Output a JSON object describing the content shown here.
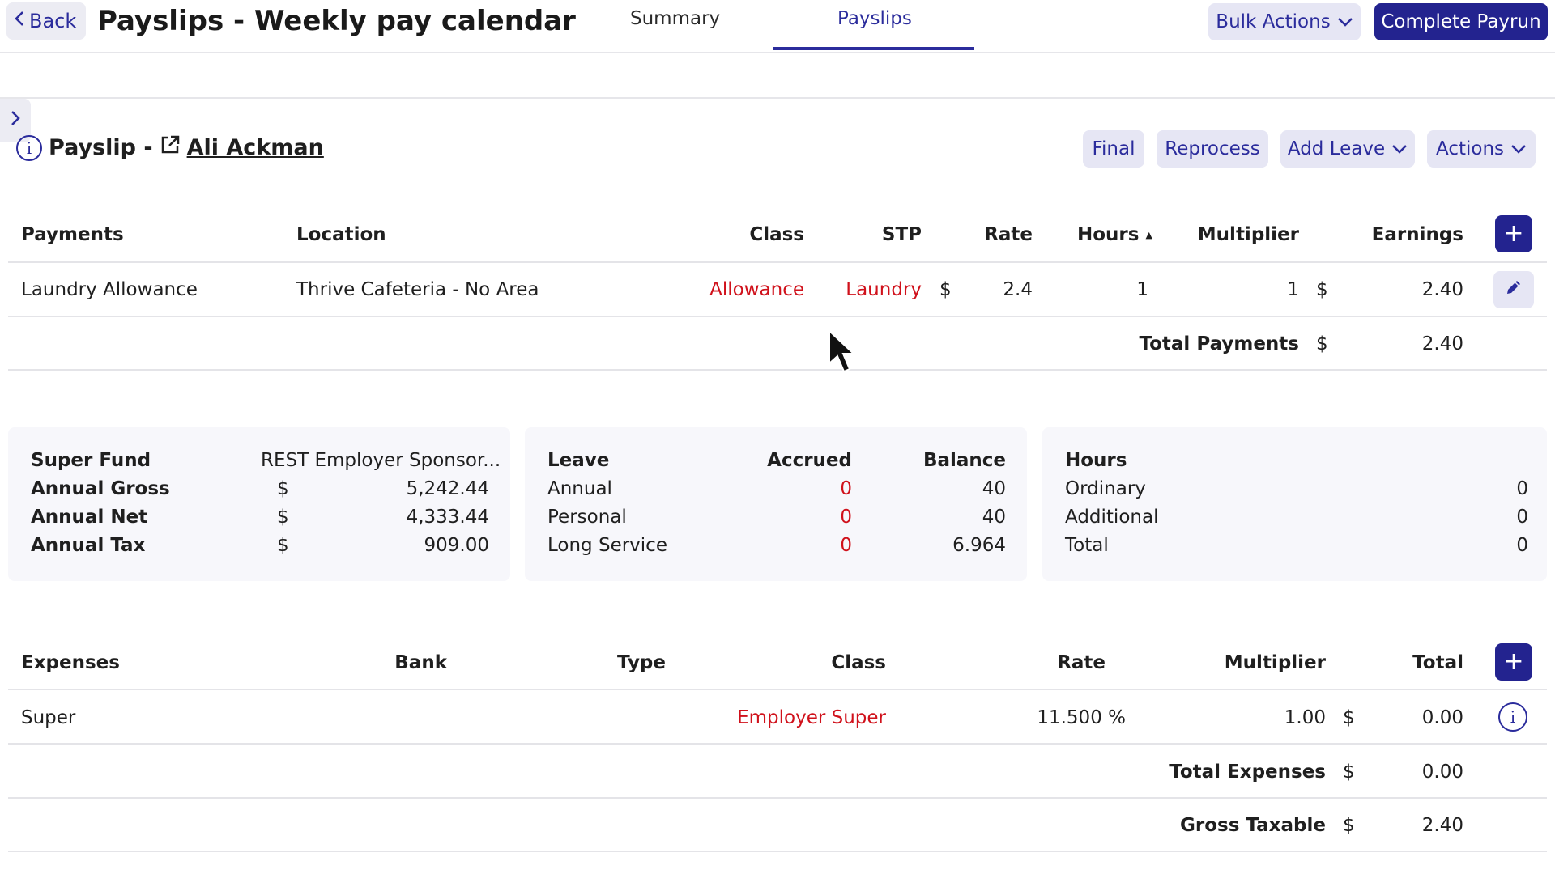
{
  "header": {
    "back_label": "Back",
    "title": "Payslips - Weekly pay calendar",
    "tabs": [
      {
        "label": "Summary",
        "active": false
      },
      {
        "label": "Payslips",
        "active": true
      }
    ],
    "bulk_actions_label": "Bulk Actions",
    "complete_payrun_label": "Complete Payrun"
  },
  "payslip": {
    "title_prefix": "Payslip -",
    "employee_name": "Ali Ackman",
    "buttons": {
      "final": "Final",
      "reprocess": "Reprocess",
      "add_leave": "Add Leave",
      "actions": "Actions"
    }
  },
  "payments": {
    "headers": {
      "payments": "Payments",
      "location": "Location",
      "class": "Class",
      "stp": "STP",
      "rate": "Rate",
      "hours": "Hours",
      "hours_sort": "▲",
      "multiplier": "Multiplier",
      "earnings": "Earnings"
    },
    "rows": [
      {
        "payment": "Laundry Allowance",
        "location": "Thrive Cafeteria - No Area",
        "class": "Allowance",
        "stp": "Laundry",
        "rate_currency": "$",
        "rate": "2.4",
        "hours": "1",
        "multiplier": "1",
        "earnings_currency": "$",
        "earnings": "2.40"
      }
    ],
    "total_label": "Total Payments",
    "total_currency": "$",
    "total_value": "2.40"
  },
  "super_card": {
    "rows": [
      {
        "label": "Super Fund",
        "currency": "",
        "value": "REST Employer Sponsor..."
      },
      {
        "label": "Annual Gross",
        "currency": "$",
        "value": "5,242.44"
      },
      {
        "label": "Annual Net",
        "currency": "$",
        "value": "4,333.44"
      },
      {
        "label": "Annual Tax",
        "currency": "$",
        "value": "909.00"
      }
    ]
  },
  "leave_card": {
    "headers": {
      "leave": "Leave",
      "accrued": "Accrued",
      "balance": "Balance"
    },
    "rows": [
      {
        "type": "Annual",
        "accrued": "0",
        "balance": "40"
      },
      {
        "type": "Personal",
        "accrued": "0",
        "balance": "40"
      },
      {
        "type": "Long Service",
        "accrued": "0",
        "balance": "6.964"
      }
    ]
  },
  "hours_card": {
    "header": "Hours",
    "rows": [
      {
        "label": "Ordinary",
        "value": "0"
      },
      {
        "label": "Additional",
        "value": "0"
      },
      {
        "label": "Total",
        "value": "0"
      }
    ]
  },
  "expenses": {
    "headers": {
      "expenses": "Expenses",
      "bank": "Bank",
      "type": "Type",
      "class": "Class",
      "rate": "Rate",
      "multiplier": "Multiplier",
      "total": "Total"
    },
    "rows": [
      {
        "expense": "Super",
        "bank": "",
        "type": "",
        "class": "Employer Super",
        "rate": "11.500 %",
        "multiplier": "1.00",
        "currency": "$",
        "total": "0.00"
      }
    ],
    "total_label": "Total Expenses",
    "total_currency": "$",
    "total_value": "0.00",
    "gross_taxable_label": "Gross Taxable",
    "gross_taxable_currency": "$",
    "gross_taxable_value": "2.40"
  },
  "colors": {
    "accent": "#2b2c9c",
    "primary_button": "#23238f",
    "soft_button": "#e6e6f4",
    "class_red": "#d0111b",
    "card_bg": "#f7f7fb"
  },
  "icons": [
    "chevron-left-icon",
    "chevron-down-icon",
    "chevron-right-icon",
    "info-icon",
    "external-link-icon",
    "plus-icon",
    "pencil-icon",
    "mouse-cursor-icon"
  ]
}
